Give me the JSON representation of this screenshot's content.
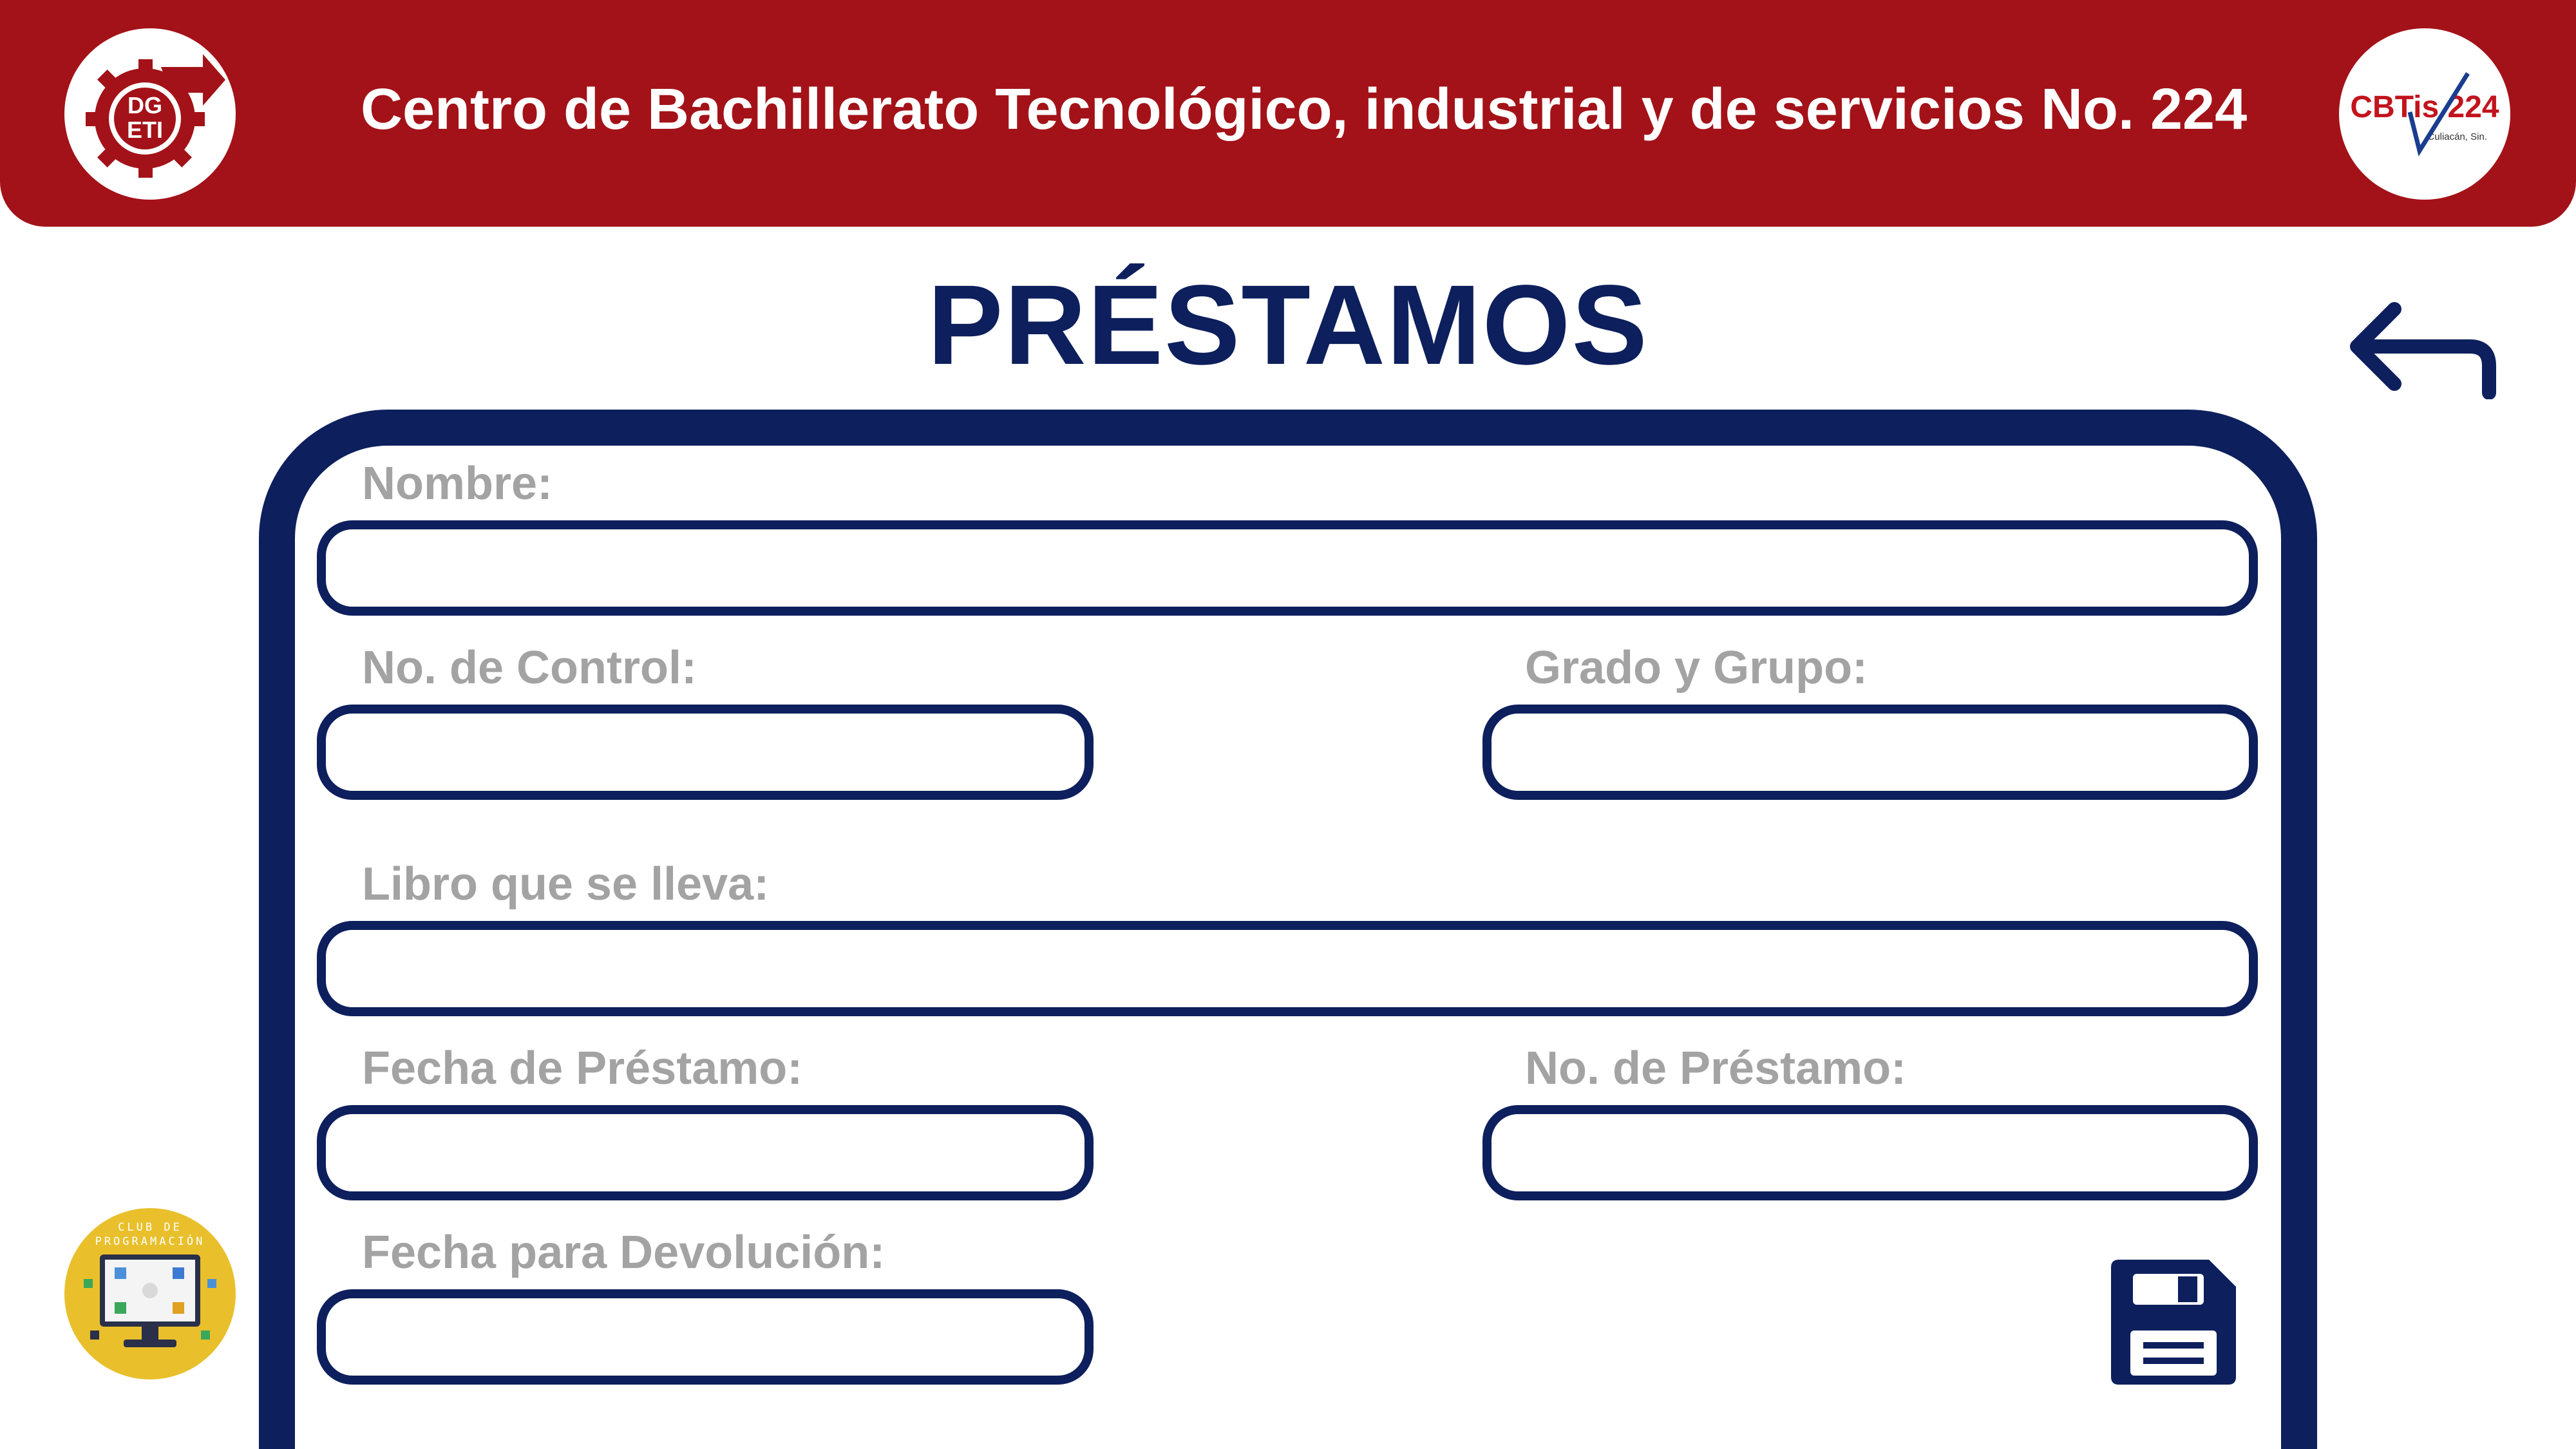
{
  "header": {
    "title": "Centro de Bachillerato Tecnológico, industrial y de servicios No. 224",
    "logo_left_text": "DGETI",
    "logo_right_text": "CBTis 224",
    "logo_right_sub": "Culiacán, Sin."
  },
  "page_title": "PRÉSTAMOS",
  "form": {
    "nombre": {
      "label": "Nombre:",
      "value": ""
    },
    "no_control": {
      "label": "No. de Control:",
      "value": ""
    },
    "grado_grupo": {
      "label": "Grado y Grupo:",
      "value": ""
    },
    "libro": {
      "label": "Libro que se lleva:",
      "value": ""
    },
    "fecha_prestamo": {
      "label": "Fecha de Préstamo:",
      "value": ""
    },
    "no_prestamo": {
      "label": "No. de Préstamo:",
      "value": ""
    },
    "fecha_devolucion": {
      "label": "Fecha para Devolución:",
      "value": ""
    }
  },
  "club_badge": {
    "line1": "CLUB DE",
    "line2": "PROGRAMACIÓN"
  },
  "icons": {
    "back": "back-arrow-icon",
    "save": "floppy-disk-icon"
  },
  "colors": {
    "header_bg": "#a31218",
    "primary_navy": "#0d1f5c",
    "label_gray": "#a3a3a3",
    "badge_yellow": "#e9c02c"
  }
}
